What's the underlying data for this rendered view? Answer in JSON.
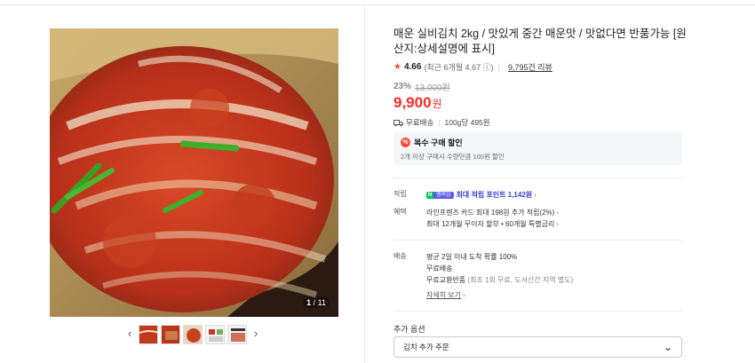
{
  "product": {
    "title": "매운 실비김치 2kg / 맛있게 중간 매운맛 / 맛없다면 반품가능 [원산지:상세설명에 표시]",
    "rating_score": "4.66",
    "rating_recent": "(최근 6개월 4.67",
    "review_link": "9,795건 리뷰",
    "discount_pct": "23%",
    "original_price": "13,000원",
    "price": "9,900",
    "currency": "원",
    "shipping": "무료배송",
    "unit_price": "100g당 495원"
  },
  "image": {
    "counter_current": "1",
    "counter_total": "/ 11",
    "prev_arrow": "‹",
    "next_arrow": "›"
  },
  "promo": {
    "badge": "%",
    "title": "복수 구매 할인",
    "desc": "2개 이상 구매시 수량만큼 100원 할인"
  },
  "benefits": {
    "point_label": "적립",
    "npay_plus": "멤버십",
    "point_text": "최대 적립 포인트 1,142원",
    "benefit_label": "혜택",
    "benefit_line1": "라인프렌즈 카드 최대 198원 추가 적립(2%)",
    "benefit_line2": "최대 12개월 무이자 할부 • 60개월 특별금리"
  },
  "delivery": {
    "label": "배송",
    "line1": "평균 2일 이내 도착 확률 100%",
    "line2": "무료배송",
    "line3_main": "무료교환반품",
    "line3_sub": "(최초 1회 무료, 도서산간 지역 별도)",
    "more": "자세히 보기"
  },
  "options": {
    "label": "추가 옵션",
    "selected": "김치 추가 주문",
    "chevron": "⌄"
  },
  "colors": {
    "price_red": "#fa2828",
    "point_blue": "#3c3cdc",
    "naver_green": "#03c75a"
  }
}
